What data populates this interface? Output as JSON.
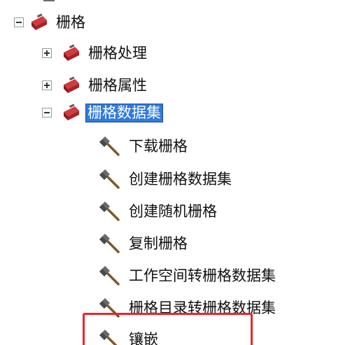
{
  "tree": {
    "root": {
      "label": "栅格",
      "expanded": true
    },
    "children": [
      {
        "label": "栅格处理",
        "expanded": false
      },
      {
        "label": "栅格属性",
        "expanded": false
      },
      {
        "label": "栅格数据集",
        "expanded": true,
        "selected": true
      }
    ],
    "tools": [
      {
        "label": "下载栅格"
      },
      {
        "label": "创建栅格数据集"
      },
      {
        "label": "创建随机栅格"
      },
      {
        "label": "复制栅格"
      },
      {
        "label": "工作空间转栅格数据集"
      },
      {
        "label": "栅格目录转栅格数据集"
      },
      {
        "label": "镶嵌",
        "highlighted": true
      }
    ]
  },
  "colors": {
    "selection": "#2f7ae0",
    "highlight_border": "#e8262d",
    "toolbox_red": "#c0282d",
    "toolbox_gray": "#6e6e6e"
  },
  "icons": {
    "toolbox": "toolbox-icon",
    "tool": "hammer-icon",
    "expand": "plus-box-icon",
    "collapse": "minus-box-icon"
  }
}
